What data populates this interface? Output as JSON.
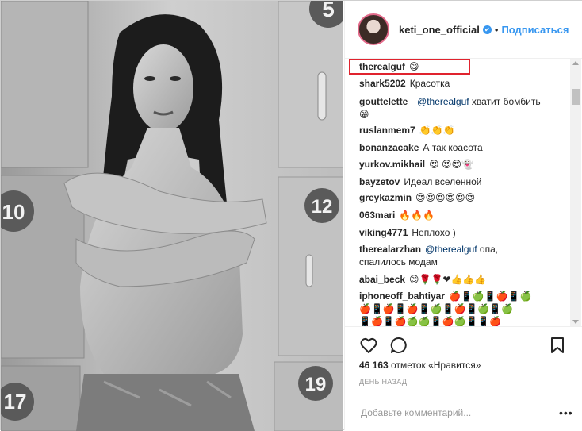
{
  "header": {
    "username": "keti_one_official",
    "verified_glyph": "✔",
    "separator": "•",
    "follow_label": "Подписаться"
  },
  "locker_numbers": [
    "5",
    "10",
    "12",
    "17",
    "19"
  ],
  "comments": [
    {
      "user": "therealguf",
      "mention": "",
      "text": "😋"
    },
    {
      "user": "shark5202",
      "mention": "",
      "text": "Красотка"
    },
    {
      "user": "gouttelette_",
      "mention": "@therealguf",
      "text": " хватит бомбить"
    },
    {
      "user": "",
      "mention": "",
      "text": "😁"
    },
    {
      "user": "ruslanmem7",
      "mention": "",
      "text": "👏👏👏"
    },
    {
      "user": "bonanzacake",
      "mention": "",
      "text": "А так коасота"
    },
    {
      "user": "yurkov.mikhail",
      "mention": "",
      "text": "😍 😍😍👻"
    },
    {
      "user": "bayzetov",
      "mention": "",
      "text": "Идеал вселенной"
    },
    {
      "user": "greykazmin",
      "mention": "",
      "text": "😍😍😍😍😍😍"
    },
    {
      "user": "063mari",
      "mention": "",
      "text": "🔥🔥🔥"
    },
    {
      "user": "viking4771",
      "mention": "",
      "text": "Неплохо )"
    },
    {
      "user": "therealarzhan",
      "mention": "@therealguf",
      "text": " опа,"
    },
    {
      "user": "",
      "mention": "",
      "text": "спалилось модам"
    },
    {
      "user": "abai_beck",
      "mention": "",
      "text": "😊🌹🌹❤👍👍👍"
    },
    {
      "user": "iphoneoff_bahtiyar",
      "mention": "",
      "text": "🍎📱🍏📱🍎📱🍏"
    },
    {
      "user": "",
      "mention": "",
      "text": "🍎📱🍎📱🍎📱🍏📱🍎📱🍏📱🍏"
    },
    {
      "user": "",
      "mention": "",
      "text": "📱🍎📱🍎🍏🍏📱🍎🍏📱📱🍎"
    }
  ],
  "likes": {
    "count": "46 163",
    "suffix": " отметок «Нравится»"
  },
  "time_ago": "ДЕНЬ НАЗАД",
  "comment_input": {
    "placeholder": "Добавьте комментарий..."
  },
  "more_label": "•••",
  "colors": {
    "accent": "#3897f0",
    "highlight": "#e0232e",
    "mention": "#003569"
  },
  "icons": [
    "heart-icon",
    "comment-icon",
    "bookmark-icon",
    "more-icon",
    "verified-icon"
  ]
}
